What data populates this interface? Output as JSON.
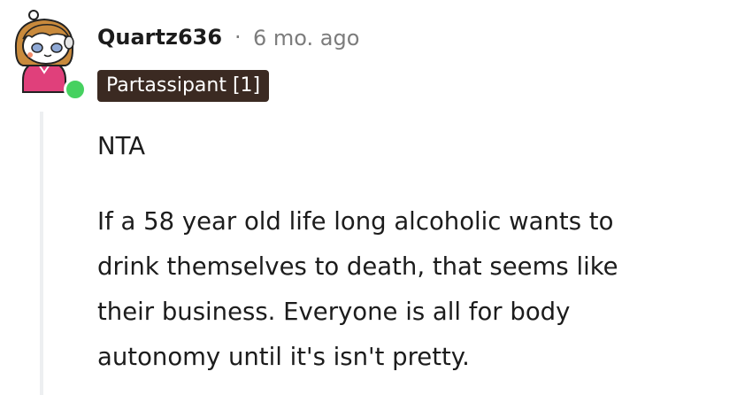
{
  "comment": {
    "username": "Quartz636",
    "separator": "·",
    "timestamp": "6 mo. ago",
    "flair": "Partassipant [1]",
    "paragraphs": [
      "NTA",
      "If a 58 year old life long alcoholic wants to\ndrink themselves to death, that seems like\ntheir business. Everyone is all for body\nautonomy until it's isn't pretty."
    ]
  },
  "colors": {
    "online": "#46d160",
    "flair_bg": "#3b2a22",
    "meta_text": "#7c7c7c",
    "thread_line": "#edeff1"
  },
  "icons": {
    "avatar": "snoo-avatar-icon",
    "online": "online-status-icon"
  }
}
